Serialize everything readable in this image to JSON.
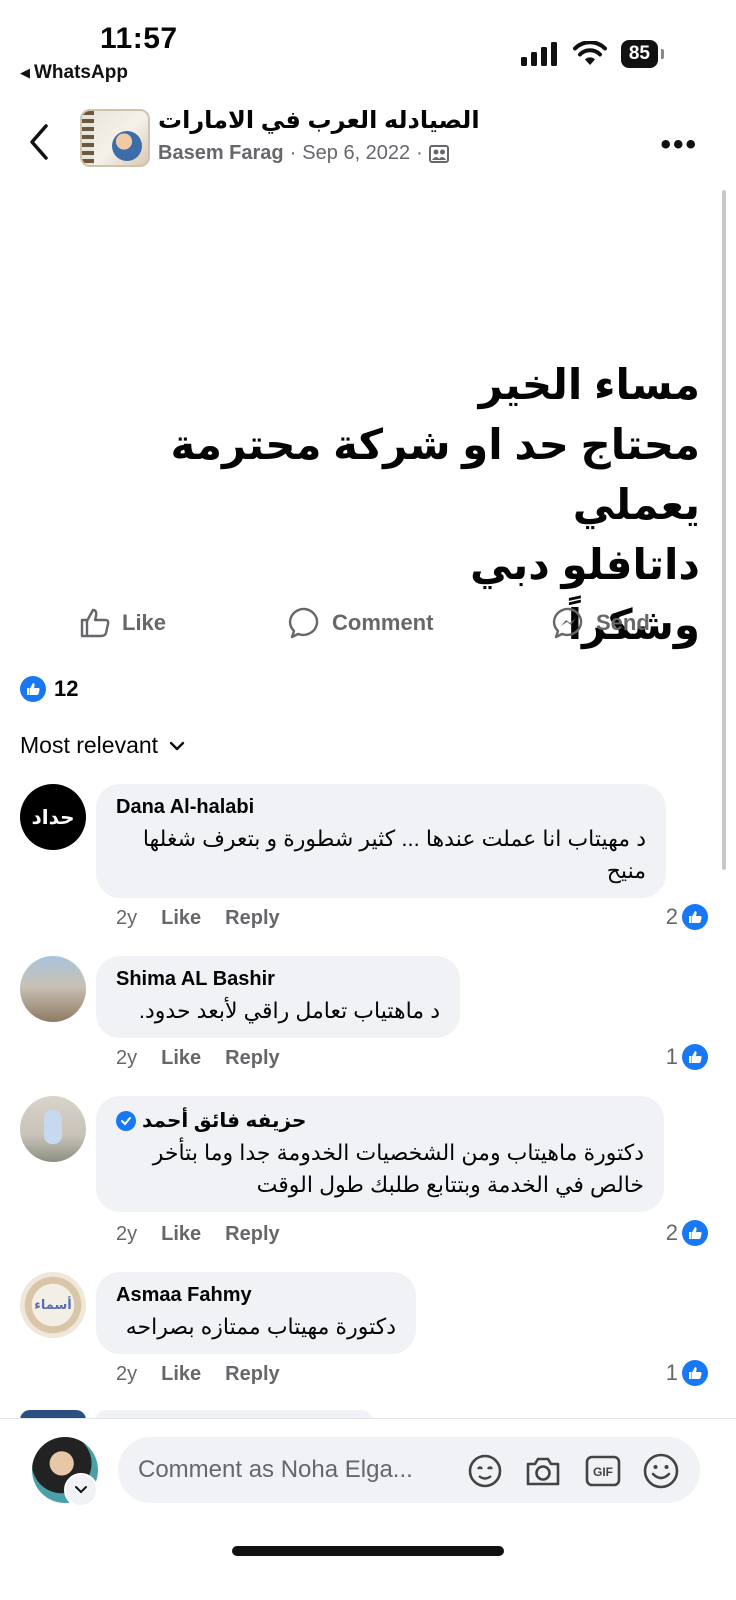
{
  "status_bar": {
    "time": "11:57",
    "back_app": "WhatsApp",
    "battery": "85"
  },
  "header": {
    "group_name": "الصيادله العرب في الامارات",
    "author": "Basem Farag",
    "date": "Sep 6, 2022",
    "separator": "·",
    "more_label": "•••"
  },
  "post": {
    "lines": [
      "مساء الخير",
      "محتاج حد او شركة محترمة يعملي",
      "داتافلو دبي",
      "وشكراً"
    ]
  },
  "actions": {
    "like": "Like",
    "comment": "Comment",
    "send": "Send"
  },
  "reactions": {
    "count": "12"
  },
  "sort": {
    "label": "Most relevant"
  },
  "comments": [
    {
      "name": "Dana Al-halabi",
      "verified": false,
      "text": "د مهيتاب انا عملت عندها ... كثير شطورة و بتعرف شغلها منيح",
      "age": "2y",
      "like": "Like",
      "reply": "Reply",
      "reactions": "2",
      "avatar_text": "حداد"
    },
    {
      "name": "Shima AL Bashir",
      "verified": false,
      "text": "د ماهتياب تعامل راقي لأبعد حدود.",
      "age": "2y",
      "like": "Like",
      "reply": "Reply",
      "reactions": "1"
    },
    {
      "name": "حزيفه  فائق  أحمد",
      "verified": true,
      "text": "دكتورة ماهيتاب ومن الشخصيات الخدومة جدا وما بتأخر خالص في الخدمة وبتتابع طلبك طول الوقت",
      "age": "2y",
      "like": "Like",
      "reply": "Reply",
      "reactions": "2"
    },
    {
      "name": "Asmaa Fahmy",
      "verified": false,
      "text": "دكتورة مهيتاب ممتازه بصراحه",
      "age": "2y",
      "like": "Like",
      "reply": "Reply",
      "reactions": "1",
      "avatar_text": "أسماء"
    }
  ],
  "composer": {
    "placeholder": "Comment as Noha Elga..."
  },
  "colors": {
    "facebook_blue": "#1877f2",
    "bubble_bg": "#f0f2f5",
    "secondary_text": "#65676b"
  }
}
